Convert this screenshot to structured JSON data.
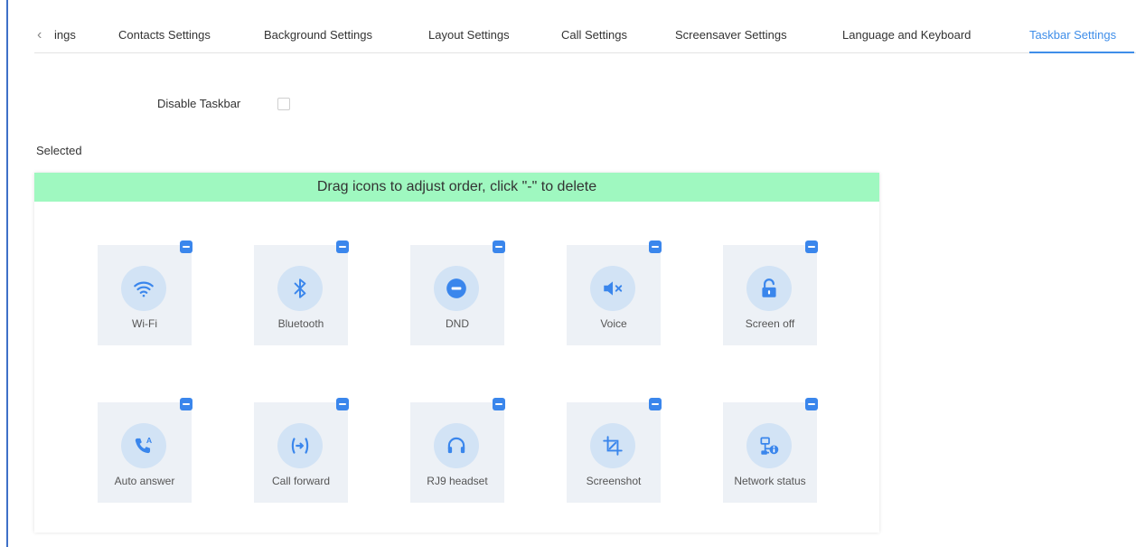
{
  "tabs": {
    "items": [
      {
        "label": "ings"
      },
      {
        "label": "Contacts Settings"
      },
      {
        "label": "Background Settings"
      },
      {
        "label": "Layout Settings"
      },
      {
        "label": "Call Settings"
      },
      {
        "label": "Screensaver Settings"
      },
      {
        "label": "Language and Keyboard"
      },
      {
        "label": "Taskbar Settings",
        "active": true
      }
    ]
  },
  "disable_taskbar": {
    "label": "Disable Taskbar",
    "checked": false
  },
  "selected": {
    "title": "Selected",
    "hint": "Drag icons to adjust order, click \"-\" to delete",
    "items": [
      {
        "label": "Wi-Fi",
        "icon": "wifi-icon"
      },
      {
        "label": "Bluetooth",
        "icon": "bluetooth-icon"
      },
      {
        "label": "DND",
        "icon": "dnd-icon"
      },
      {
        "label": "Voice",
        "icon": "speaker-mute-icon"
      },
      {
        "label": "Screen off",
        "icon": "lock-icon"
      },
      {
        "label": "Auto answer",
        "icon": "auto-answer-icon"
      },
      {
        "label": "Call forward",
        "icon": "call-forward-icon"
      },
      {
        "label": "RJ9 headset",
        "icon": "headset-icon"
      },
      {
        "label": "Screenshot",
        "icon": "crop-icon"
      },
      {
        "label": "Network status",
        "icon": "network-status-icon"
      }
    ]
  },
  "colors": {
    "accent": "#3f8ee9",
    "banner": "#9ff8c0",
    "tile_bg": "#edf1f6",
    "icon_circle": "#d2e3f5",
    "icon_fg": "#3a86ec"
  }
}
